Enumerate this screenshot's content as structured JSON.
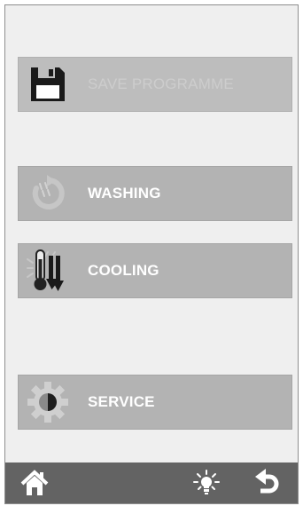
{
  "menu": {
    "save_label": "SAVE PROGRAMME",
    "washing_label": "WASHING",
    "cooling_label": "COOLING",
    "service_label": "SERVICE"
  },
  "icons": {
    "save": "floppy-disk-icon",
    "washing": "washing-cycle-icon",
    "cooling": "thermometer-cooling-icon",
    "service": "gear-icon",
    "home": "home-icon",
    "light": "light-bulb-icon",
    "back": "back-arrow-icon"
  },
  "colors": {
    "background": "#efefef",
    "button": "#b3b3b3",
    "bottom_bar": "#636363",
    "label": "#ffffff"
  }
}
